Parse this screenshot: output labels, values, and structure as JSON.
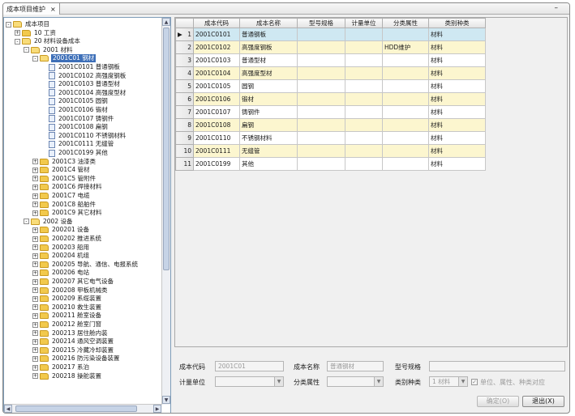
{
  "tab": {
    "label": "成本项目维护",
    "close": "×"
  },
  "window": {
    "minimize": "–"
  },
  "tree": {
    "nodes": [
      {
        "depth": 0,
        "tog": "-",
        "icon": "folder-open",
        "label": "成本项目"
      },
      {
        "depth": 1,
        "tog": "+",
        "icon": "folder",
        "label": "10 工资"
      },
      {
        "depth": 1,
        "tog": "-",
        "icon": "folder-open",
        "label": "20 材料设备成本"
      },
      {
        "depth": 2,
        "tog": "-",
        "icon": "folder-open",
        "label": "2001 材料"
      },
      {
        "depth": 3,
        "tog": "-",
        "icon": "folder-open",
        "label": "2001C01 钢材",
        "selected": true
      },
      {
        "depth": 4,
        "tog": "",
        "icon": "doc",
        "label": "2001C0101 普通钢板"
      },
      {
        "depth": 4,
        "tog": "",
        "icon": "doc",
        "label": "2001C0102 高强度钢板"
      },
      {
        "depth": 4,
        "tog": "",
        "icon": "doc",
        "label": "2001C0103 普通型材"
      },
      {
        "depth": 4,
        "tog": "",
        "icon": "doc",
        "label": "2001C0104 高强度型材"
      },
      {
        "depth": 4,
        "tog": "",
        "icon": "doc",
        "label": "2001C0105 圆钢"
      },
      {
        "depth": 4,
        "tog": "",
        "icon": "doc",
        "label": "2001C0106 锻材"
      },
      {
        "depth": 4,
        "tog": "",
        "icon": "doc",
        "label": "2001C0107 铸钢件"
      },
      {
        "depth": 4,
        "tog": "",
        "icon": "doc",
        "label": "2001C0108 扁钢"
      },
      {
        "depth": 4,
        "tog": "",
        "icon": "doc",
        "label": "2001C0110 不锈钢材料"
      },
      {
        "depth": 4,
        "tog": "",
        "icon": "doc",
        "label": "2001C0111 无缝管"
      },
      {
        "depth": 4,
        "tog": "",
        "icon": "doc",
        "label": "2001C0199 其他"
      },
      {
        "depth": 3,
        "tog": "+",
        "icon": "folder",
        "label": "2001C3 油漆类"
      },
      {
        "depth": 3,
        "tog": "+",
        "icon": "folder",
        "label": "2001C4 管材"
      },
      {
        "depth": 3,
        "tog": "+",
        "icon": "folder",
        "label": "2001C5 管附件"
      },
      {
        "depth": 3,
        "tog": "+",
        "icon": "folder",
        "label": "2001C6 焊接材料"
      },
      {
        "depth": 3,
        "tog": "+",
        "icon": "folder",
        "label": "2001C7 电缆"
      },
      {
        "depth": 3,
        "tog": "+",
        "icon": "folder",
        "label": "2001C8 船舶件"
      },
      {
        "depth": 3,
        "tog": "+",
        "icon": "folder",
        "label": "2001C9 其它材料"
      },
      {
        "depth": 2,
        "tog": "-",
        "icon": "folder-open",
        "label": "2002 设备"
      },
      {
        "depth": 3,
        "tog": "+",
        "icon": "folder",
        "label": "200201 设备"
      },
      {
        "depth": 3,
        "tog": "+",
        "icon": "folder",
        "label": "200202 推进系统"
      },
      {
        "depth": 3,
        "tog": "+",
        "icon": "folder",
        "label": "200203 船用"
      },
      {
        "depth": 3,
        "tog": "+",
        "icon": "folder",
        "label": "200204 机组"
      },
      {
        "depth": 3,
        "tog": "+",
        "icon": "folder",
        "label": "200205 导航、通信、电报系统"
      },
      {
        "depth": 3,
        "tog": "+",
        "icon": "folder",
        "label": "200206 电站"
      },
      {
        "depth": 3,
        "tog": "+",
        "icon": "folder",
        "label": "200207 其它电气设备"
      },
      {
        "depth": 3,
        "tog": "+",
        "icon": "folder",
        "label": "200208 甲板机械类"
      },
      {
        "depth": 3,
        "tog": "+",
        "icon": "folder",
        "label": "200209 系缆装置"
      },
      {
        "depth": 3,
        "tog": "+",
        "icon": "folder",
        "label": "200210 救生装置"
      },
      {
        "depth": 3,
        "tog": "+",
        "icon": "folder",
        "label": "200211 舱室设备"
      },
      {
        "depth": 3,
        "tog": "+",
        "icon": "folder",
        "label": "200212 舱室门窗"
      },
      {
        "depth": 3,
        "tog": "+",
        "icon": "folder",
        "label": "200213 居住舱内装"
      },
      {
        "depth": 3,
        "tog": "+",
        "icon": "folder",
        "label": "200214 通风空调装置"
      },
      {
        "depth": 3,
        "tog": "+",
        "icon": "folder",
        "label": "200215 冷藏冷却装置"
      },
      {
        "depth": 3,
        "tog": "+",
        "icon": "folder",
        "label": "200216 防污染设备装置"
      },
      {
        "depth": 3,
        "tog": "+",
        "icon": "folder",
        "label": "200217 系泊"
      },
      {
        "depth": 3,
        "tog": "+",
        "icon": "folder",
        "label": "200218 操舵装置"
      }
    ],
    "scroll": {
      "up": "▲",
      "down": "▼",
      "left": "◀",
      "right": "▶"
    }
  },
  "grid": {
    "columns": [
      "成本代码",
      "成本名称",
      "型号规格",
      "计量单位",
      "分类属性",
      "类别种类"
    ],
    "rows": [
      {
        "num": "1",
        "marker": "▶",
        "code": "2001C0101",
        "name": "普通钢板",
        "spec": "",
        "unit": "",
        "cls": "",
        "type": "材料"
      },
      {
        "num": "2",
        "marker": "",
        "code": "2001C0102",
        "name": "高强度钢板",
        "spec": "",
        "unit": "",
        "cls": "HDD维护",
        "type": "材料"
      },
      {
        "num": "3",
        "marker": "",
        "code": "2001C0103",
        "name": "普通型材",
        "spec": "",
        "unit": "",
        "cls": "",
        "type": "材料"
      },
      {
        "num": "4",
        "marker": "",
        "code": "2001C0104",
        "name": "高强度型材",
        "spec": "",
        "unit": "",
        "cls": "",
        "type": "材料"
      },
      {
        "num": "5",
        "marker": "",
        "code": "2001C0105",
        "name": "圆钢",
        "spec": "",
        "unit": "",
        "cls": "",
        "type": "材料"
      },
      {
        "num": "6",
        "marker": "",
        "code": "2001C0106",
        "name": "锻材",
        "spec": "",
        "unit": "",
        "cls": "",
        "type": "材料"
      },
      {
        "num": "7",
        "marker": "",
        "code": "2001C0107",
        "name": "铸钢件",
        "spec": "",
        "unit": "",
        "cls": "",
        "type": "材料"
      },
      {
        "num": "8",
        "marker": "",
        "code": "2001C0108",
        "name": "扁钢",
        "spec": "",
        "unit": "",
        "cls": "",
        "type": "材料"
      },
      {
        "num": "9",
        "marker": "",
        "code": "2001C0110",
        "name": "不锈钢材料",
        "spec": "",
        "unit": "",
        "cls": "",
        "type": "材料"
      },
      {
        "num": "10",
        "marker": "",
        "code": "2001C0111",
        "name": "无缝管",
        "spec": "",
        "unit": "",
        "cls": "",
        "type": "材料"
      },
      {
        "num": "11",
        "marker": "",
        "code": "2001C0199",
        "name": "其他",
        "spec": "",
        "unit": "",
        "cls": "",
        "type": "材料"
      }
    ]
  },
  "form": {
    "code_label": "成本代码",
    "code_value": "2001C01",
    "name_label": "成本名称",
    "name_value": "普通钢材",
    "spec_label": "型号规格",
    "spec_value": "",
    "unit_label": "计量单位",
    "cls_label": "分类属性",
    "type_label": "类别种类",
    "type_value": "1 材料",
    "check_label": "单位、属性、种类对应",
    "confirm_button": "确定(O)",
    "exit_button": "退出(X)"
  }
}
